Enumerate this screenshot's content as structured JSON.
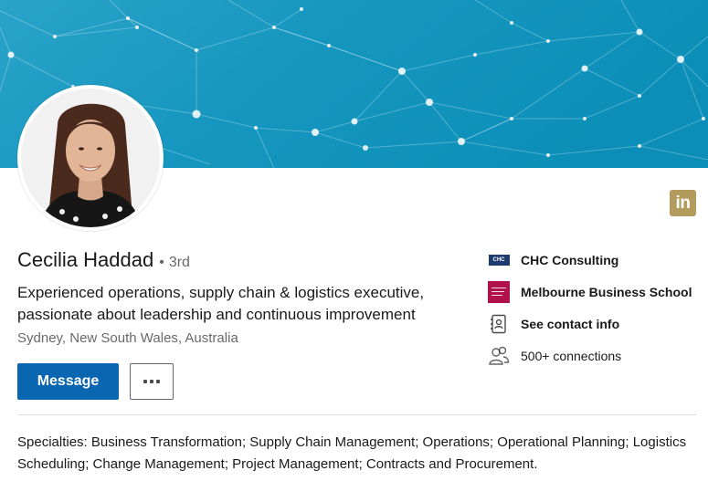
{
  "banner": {
    "colors": {
      "left": "#2aa3c9",
      "right": "#0b8fb8"
    },
    "image": "network-constellation-banner"
  },
  "profile": {
    "name": "Cecilia Haddad",
    "separator": "•",
    "degree": "3rd",
    "headline": "Experienced operations, supply chain & logistics executive, passionate about leadership and continuous improvement",
    "location": "Sydney, New South Wales, Australia",
    "avatar": "profile-photo"
  },
  "badge": {
    "icon": "linkedin-icon",
    "text": "in",
    "color": "#b39a5d"
  },
  "actions": {
    "message_label": "Message",
    "more_icon": "ellipsis-icon",
    "message_color": "#0a66b0"
  },
  "sidebar": {
    "items": [
      {
        "label": "CHC Consulting",
        "icon": "company-logo",
        "logo_text": "CHC"
      },
      {
        "label": "Melbourne Business School",
        "icon": "school-logo"
      },
      {
        "label": "See contact info",
        "icon": "contact-card-icon"
      },
      {
        "label": "500+ connections",
        "icon": "people-icon"
      }
    ]
  },
  "about": {
    "specialties": "Specialties: Business Transformation; Supply Chain Management; Operations; Operational Planning; Logistics Scheduling; Change Management; Project Management; Contracts and Procurement."
  }
}
